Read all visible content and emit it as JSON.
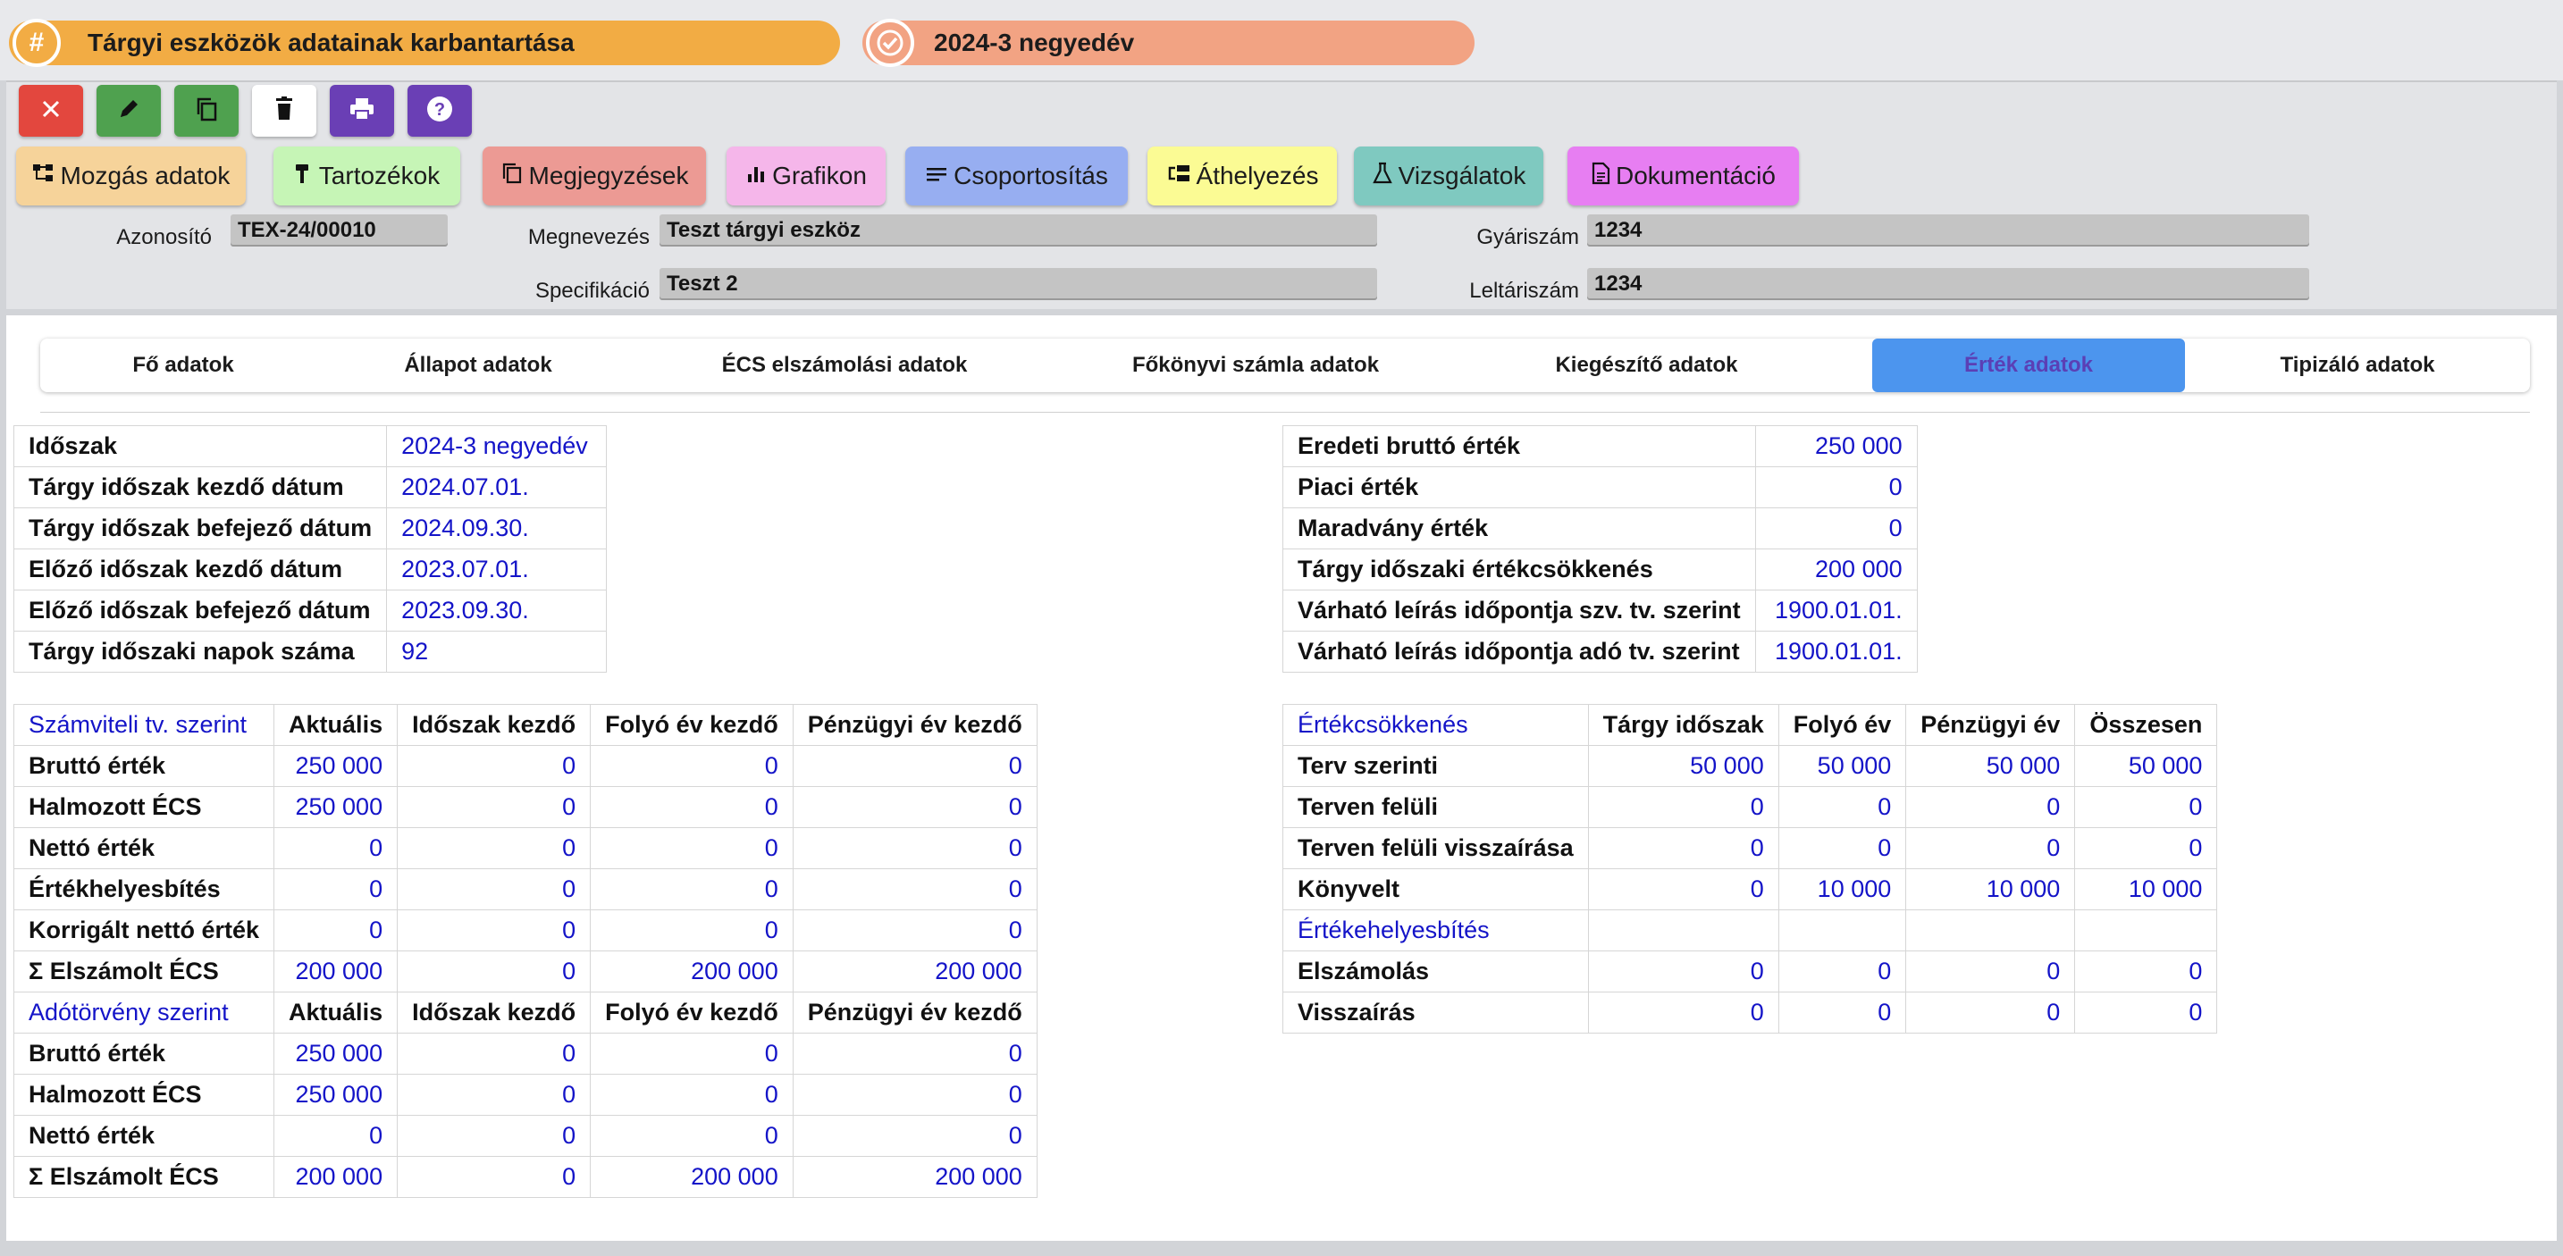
{
  "title_pills": {
    "module_title": "Tárgyi eszközök adatainak karbantartása",
    "module_icon": "#",
    "period_title": "2024-3 negyedév"
  },
  "toolbar": {
    "icon_buttons": [
      "close-icon",
      "pencil-icon",
      "copy-icon",
      "trash-icon",
      "printer-icon",
      "help-icon"
    ],
    "colors": {
      "close": "#e3473e",
      "green": "#4fa14f",
      "purple": "#6a3fb5"
    }
  },
  "section_buttons": {
    "mozgas": "Mozgás adatok",
    "tartozekok": "Tartozékok",
    "megjegyzesek": "Megjegyzések",
    "grafikon": "Grafikon",
    "csoportositas": "Csoportosítás",
    "athelyezes": "Áthelyezés",
    "vizsgalatok": "Vizsgálatok",
    "dokumentacio": "Dokumentáció"
  },
  "fields": {
    "azonosito": {
      "label": "Azonosító",
      "value": "TEX-24/00010"
    },
    "megnevezes": {
      "label": "Megnevezés",
      "value": "Teszt tárgyi eszköz"
    },
    "gyariszam": {
      "label": "Gyáriszám",
      "value": "1234"
    },
    "specifikacio": {
      "label": "Specifikáció",
      "value": "Teszt 2"
    },
    "leltariszam": {
      "label": "Leltáriszám",
      "value": "1234"
    }
  },
  "tabs": {
    "items": [
      "Fő adatok",
      "Állapot adatok",
      "ÉCS elszámolási adatok",
      "Főkönyvi számla adatok",
      "Kiegészítő adatok",
      "Érték adatok",
      "Tipizáló adatok"
    ],
    "active": "Érték adatok"
  },
  "period_table": [
    {
      "label": "Időszak",
      "value": "2024-3 negyedév"
    },
    {
      "label": "Tárgy időszak kezdő dátum",
      "value": "2024.07.01."
    },
    {
      "label": "Tárgy időszak befejező dátum",
      "value": "2024.09.30."
    },
    {
      "label": "Előző időszak kezdő dátum",
      "value": "2023.07.01."
    },
    {
      "label": "Előző időszak befejező dátum",
      "value": "2023.09.30."
    },
    {
      "label": "Tárgy időszaki napok száma",
      "value": "92"
    }
  ],
  "value_table": [
    {
      "label": "Eredeti bruttó érték",
      "value": "250 000"
    },
    {
      "label": "Piaci érték",
      "value": "0"
    },
    {
      "label": "Maradvány érték",
      "value": "0"
    },
    {
      "label": "Tárgy időszaki értékcsökkenés",
      "value": "200 000"
    },
    {
      "label": "Várható leírás időpontja szv. tv. szerint",
      "value": "1900.01.01."
    },
    {
      "label": "Várható leírás időpontja adó tv. szerint",
      "value": "1900.01.01."
    }
  ],
  "accounting_table": {
    "sections": [
      {
        "title": "Számviteli tv. szerint",
        "headers": [
          "Aktuális",
          "Időszak kezdő",
          "Folyó év kezdő",
          "Pénzügyi év kezdő"
        ],
        "rows": [
          {
            "label": "Bruttó érték",
            "values": [
              "250 000",
              "0",
              "0",
              "0"
            ]
          },
          {
            "label": "Halmozott ÉCS",
            "values": [
              "250 000",
              "0",
              "0",
              "0"
            ]
          },
          {
            "label": "Nettó érték",
            "values": [
              "0",
              "0",
              "0",
              "0"
            ]
          },
          {
            "label": "Értékhelyesbítés",
            "values": [
              "0",
              "0",
              "0",
              "0"
            ]
          },
          {
            "label": "Korrigált nettó érték",
            "values": [
              "0",
              "0",
              "0",
              "0"
            ]
          },
          {
            "label": "Σ Elszámolt ÉCS",
            "values": [
              "200 000",
              "0",
              "200 000",
              "200 000"
            ]
          }
        ]
      },
      {
        "title": "Adótörvény szerint",
        "headers": [
          "Aktuális",
          "Időszak kezdő",
          "Folyó év kezdő",
          "Pénzügyi év kezdő"
        ],
        "rows": [
          {
            "label": "Bruttó érték",
            "values": [
              "250 000",
              "0",
              "0",
              "0"
            ]
          },
          {
            "label": "Halmozott ÉCS",
            "values": [
              "250 000",
              "0",
              "0",
              "0"
            ]
          },
          {
            "label": "Nettó érték",
            "values": [
              "0",
              "0",
              "0",
              "0"
            ]
          },
          {
            "label": "Σ Elszámolt ÉCS",
            "values": [
              "200 000",
              "0",
              "200 000",
              "200 000"
            ]
          }
        ]
      }
    ]
  },
  "depreciation_table": {
    "title": "Értékcsökkenés",
    "headers": [
      "Tárgy időszak",
      "Folyó év",
      "Pénzügyi év",
      "Összesen"
    ],
    "rows": [
      {
        "label": "Terv szerinti",
        "values": [
          "50 000",
          "50 000",
          "50 000",
          "50 000"
        ]
      },
      {
        "label": "Terven felüli",
        "values": [
          "0",
          "0",
          "0",
          "0"
        ]
      },
      {
        "label": "Terven felüli visszaírása",
        "values": [
          "0",
          "0",
          "0",
          "0"
        ]
      },
      {
        "label": "Könyvelt",
        "values": [
          "0",
          "10 000",
          "10 000",
          "10 000"
        ]
      }
    ],
    "subtitle": "Értékehelyesbítés",
    "sub_rows": [
      {
        "label": "Elszámolás",
        "values": [
          "0",
          "0",
          "0",
          "0"
        ]
      },
      {
        "label": "Visszaírás",
        "values": [
          "0",
          "0",
          "0",
          "0"
        ]
      }
    ]
  }
}
